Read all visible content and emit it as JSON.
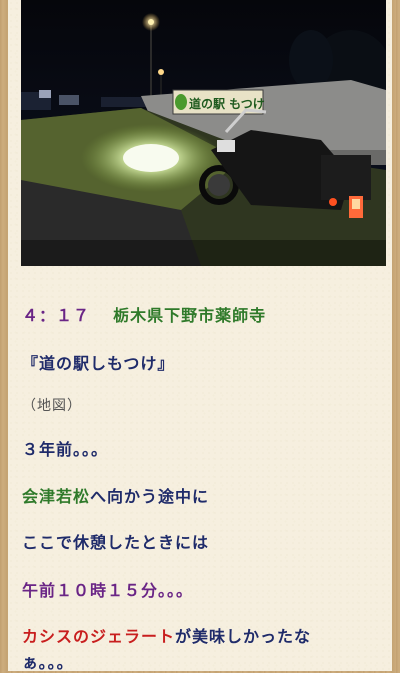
{
  "photo": {
    "sign_text": "道の駅しもつけ",
    "sign_visible_text": "道の駅 もつけ",
    "description_icon": "night-photo-motorcycle"
  },
  "post": {
    "time": "４：１７",
    "location": "栃木県下野市薬師寺",
    "station_name": "『道の駅しもつけ』",
    "map_link": "（地図）",
    "line_years": "３年前。。。",
    "line_aizu_a": "会津若松",
    "line_aizu_b": "へ向かう途中に",
    "line_rest": "ここで休憩したときには",
    "line_time": "午前１０時１５分。。。",
    "line_gelato_a": "カシスのジェラート",
    "line_gelato_b": "が美味しかったな",
    "line_end": "ぁ。。。"
  },
  "colors": {
    "wood": "#c9a878",
    "paper": "#f6efdf",
    "navy": "#1f2b6a",
    "purple": "#6a2586",
    "green": "#2f7a2a",
    "red": "#c81e1e"
  }
}
